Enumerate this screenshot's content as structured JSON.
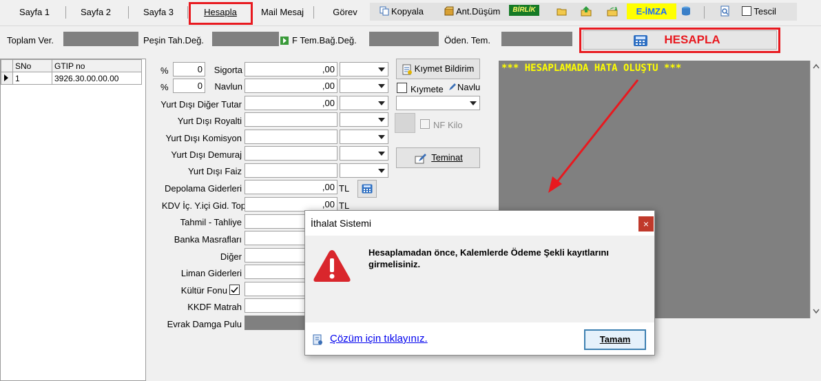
{
  "tabs": {
    "sayfa1": "Sayfa 1",
    "sayfa2": "Sayfa 2",
    "sayfa3": "Sayfa 3",
    "hesapla": "Hesapla",
    "mail": "Mail Mesaj",
    "gorev": "Görev"
  },
  "toolbar": {
    "kopyala": "Kopyala",
    "ant_dusum": "Ant.Düşüm",
    "birlik": "BİRLİK",
    "e_imza": "E-İMZA",
    "tescil": "Tescil"
  },
  "totals": {
    "toplam_ver": "Toplam Ver.",
    "pesin_tah": "Peşin Tah.Değ.",
    "f_tem": "F Tem.Bağ.Değ.",
    "oden_tem": "Öden. Tem.",
    "hesapla_button": "HESAPLA"
  },
  "grid": {
    "columns": [
      "SNo",
      "GTIP no"
    ],
    "rows": [
      {
        "sno": "1",
        "gtip": "3926.30.00.00.00"
      }
    ]
  },
  "form": {
    "sigorta_pct": "0",
    "sigorta_label": "Sigorta",
    "sigorta_value": ",00",
    "navlun_pct": "0",
    "navlun_label": "Navlun",
    "navlun_value": ",00",
    "percent_sign": "%",
    "yd_diger_label": "Yurt Dışı Diğer Tutar",
    "yd_diger_value": ",00",
    "yd_royalti_label": "Yurt Dışı Royalti",
    "yd_komisyon_label": "Yurt Dışı Komisyon",
    "yd_demuraj_label": "Yurt Dışı Demuraj",
    "yd_faiz_label": "Yurt Dışı Faiz",
    "depolama_label": "Depolama Giderleri",
    "depolama_value": ",00",
    "depolama_unit": "TL",
    "kdv_label": "KDV İç. Y.içi Gid. Top",
    "kdv_value": ",00",
    "kdv_unit": "TL",
    "tahmil_label": "Tahmil - Tahliye",
    "banka_label": "Banka Masrafları",
    "diger_label": "Diğer",
    "liman_label": "Liman Giderleri",
    "kultur_label": "Kültür Fonu",
    "kkdf_label": "KKDF Matrah",
    "evrak_label": "Evrak Damga Pulu"
  },
  "side": {
    "kiymet_bildirim": "Kıymet Bildirim",
    "kiymet_check": "Kıymete",
    "navlun_btn": "Navlu",
    "nf_kilo": "NF Kilo",
    "teminat": "Teminat"
  },
  "output": {
    "message": "*** HESAPLAMADA HATA OLUŞTU ***"
  },
  "dialog": {
    "title": "İthalat Sistemi",
    "close": "×",
    "message": "Hesaplamadan önce, Kalemlerde Ödeme Şekli kayıtlarını girmelisiniz.",
    "link": "Çözüm için tıklayınız.",
    "ok": "Tamam"
  },
  "colors": {
    "highlight_red": "#e8191f",
    "output_bg": "#808080",
    "output_text": "#ffff00",
    "error_icon": "#d9262c"
  }
}
